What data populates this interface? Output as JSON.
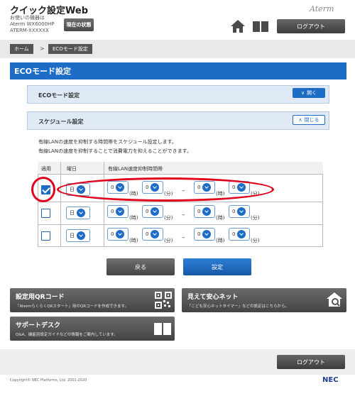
{
  "header": {
    "title": "クイック設定Web",
    "device_label": "お使いの機器は",
    "device_model": "Aterm WX6000HP",
    "device_id": "ATERM-XXXXXX",
    "status_button": "現在の状態",
    "logo": "Aterm",
    "logout": "ログアウト"
  },
  "breadcrumb": {
    "home": "ホーム",
    "separator": ">",
    "current": "ECOモード設定"
  },
  "page_title": "ECOモード設定",
  "sections": {
    "eco": {
      "label": "ECOモード設定",
      "toggle": "開く"
    },
    "schedule": {
      "label": "スケジュール設定",
      "toggle": "閉じる"
    }
  },
  "description": {
    "line1": "有線LANの速度を抑制する時間帯をスケジュール設定します。",
    "line2": "有線LANの速度を抑制することで消費電力を抑えることができます。"
  },
  "table": {
    "headers": {
      "apply": "適用",
      "day": "曜日",
      "time": "有線LAN速度抑制時間帯"
    },
    "units": {
      "hour": "(時)",
      "minute": "(分)",
      "dash": "–"
    },
    "rows": [
      {
        "checked": true,
        "day": "日",
        "start_h": "0",
        "start_m": "0",
        "end_h": "0",
        "end_m": "0"
      },
      {
        "checked": false,
        "day": "日",
        "start_h": "0",
        "start_m": "0",
        "end_h": "0",
        "end_m": "0"
      },
      {
        "checked": false,
        "day": "日",
        "start_h": "0",
        "start_m": "0",
        "end_h": "0",
        "end_m": "0"
      }
    ]
  },
  "actions": {
    "back": "戻る",
    "set": "設定"
  },
  "tiles": {
    "qr": {
      "title": "設定用QRコード",
      "sub": "「AtermらくらくQRスタート」用のQRコードを作成できます。"
    },
    "safe": {
      "title": "見えて安心ネット",
      "sub": "「こども安心ネットタイマー」などの設定はこちらから。"
    },
    "support": {
      "title": "サポートデスク",
      "sub": "Q&A、機能別設定ガイドなどの情報をご案内しています。"
    }
  },
  "footer": {
    "logout": "ログアウト",
    "copyright": "Copyright© NEC Platforms, Ltd. 2001-2020",
    "brand": "NEC"
  },
  "colors": {
    "accent": "#1d6cc6",
    "highlight": "#e0001b"
  }
}
